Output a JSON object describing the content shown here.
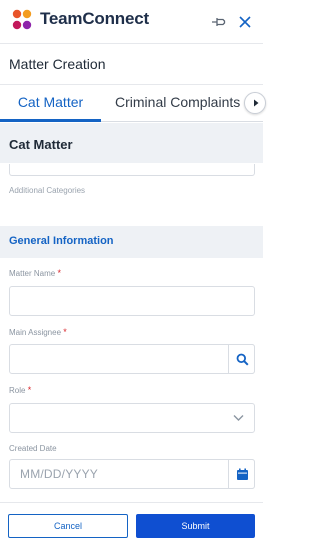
{
  "header": {
    "brand": "TeamConnect",
    "icons": [
      "teamconnect-logo-icon",
      "pin-icon",
      "close-icon"
    ]
  },
  "page": {
    "title": "Matter Creation"
  },
  "tabs": [
    {
      "label": "Cat Matter",
      "active": true
    },
    {
      "label": "Criminal Complaints",
      "active": false
    }
  ],
  "cat_section": {
    "title": "Cat Matter",
    "additional_categories_label": "Additional Categories"
  },
  "general_section": {
    "title": "General Information",
    "fields": {
      "matter_name": {
        "label": "Matter Name",
        "required_mark": "*",
        "value": ""
      },
      "main_assignee": {
        "label": "Main Assignee",
        "required_mark": "*",
        "value": ""
      },
      "role": {
        "label": "Role",
        "required_mark": "*",
        "value": ""
      },
      "created_date": {
        "label": "Created Date",
        "placeholder": "MM/DD/YYYY",
        "value": ""
      }
    }
  },
  "actions": {
    "cancel": "Cancel",
    "submit": "Submit"
  },
  "colors": {
    "accent": "#1463c4",
    "primary_button": "#0f4fd1",
    "required": "#d9262c",
    "section_bg": "#eef1f5"
  }
}
